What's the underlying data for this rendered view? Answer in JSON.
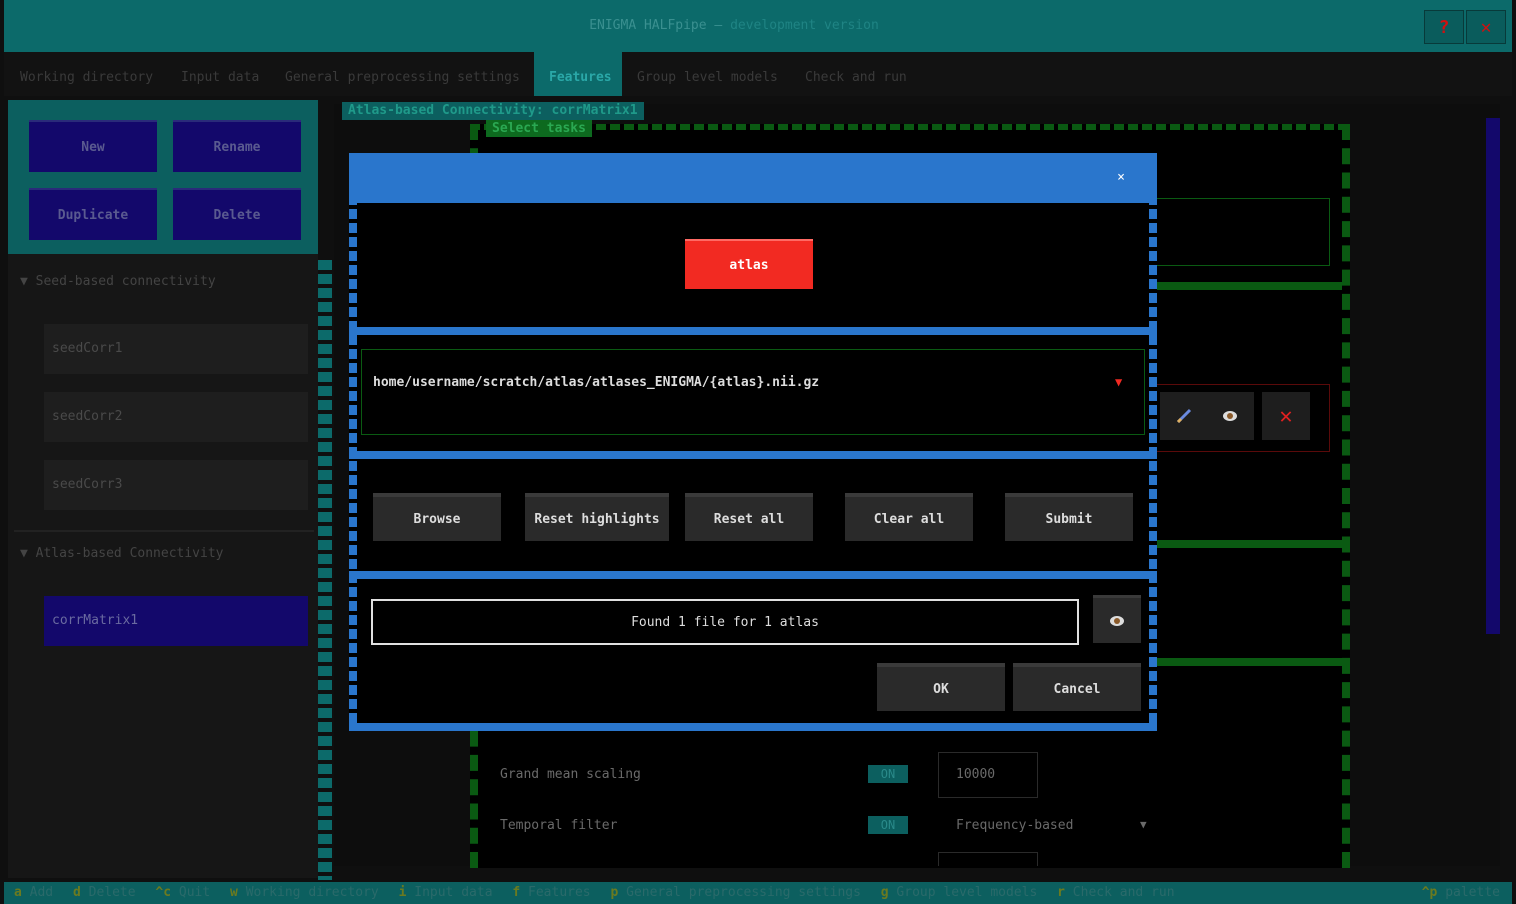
{
  "window": {
    "title": "ENIGMA HALFpipe —",
    "subtitle": "development version",
    "help_label": "?",
    "close_label": "✕"
  },
  "tabs": [
    {
      "label": "Working directory"
    },
    {
      "label": "Input data"
    },
    {
      "label": "General preprocessing settings"
    },
    {
      "label": "Features"
    },
    {
      "label": "Group level models"
    },
    {
      "label": "Check and run"
    }
  ],
  "sidebar": {
    "buttons": {
      "new": "New",
      "rename": "Rename",
      "duplicate": "Duplicate",
      "delete": "Delete"
    },
    "seed_section": "▼ Seed-based connectivity",
    "seed_items": [
      "seedCorr1",
      "seedCorr2",
      "seedCorr3"
    ],
    "atlas_section": "▼ Atlas-based Connectivity",
    "atlas_items": [
      "corrMatrix1"
    ]
  },
  "main": {
    "panel_title": "Atlas-based Connectivity: corrMatrix1",
    "select_tasks": "Select tasks",
    "rows": [
      {
        "label": "Grand mean scaling",
        "toggle": "ON",
        "value": "10000"
      },
      {
        "label": "Temporal filter",
        "toggle": "ON",
        "value": "Frequency-based"
      }
    ]
  },
  "modal": {
    "close": "×",
    "tag": "atlas",
    "path": "home/username/scratch/atlas/atlases_ENIGMA/{atlas}.nii.gz",
    "dropdown_arrow": "▼",
    "buttons": {
      "browse": "Browse",
      "reset_highlights": "Reset highlights",
      "reset_all": "Reset all",
      "clear_all": "Clear all",
      "submit": "Submit"
    },
    "status": "Found 1 file for 1 atlas",
    "ok": "OK",
    "cancel": "Cancel"
  },
  "statusbar": {
    "items": [
      {
        "key": "a",
        "label": "Add"
      },
      {
        "key": "d",
        "label": "Delete"
      },
      {
        "key": "^c",
        "label": "Quit"
      },
      {
        "key": "w",
        "label": "Working directory"
      },
      {
        "key": "i",
        "label": "Input data"
      },
      {
        "key": "f",
        "label": "Features"
      },
      {
        "key": "p",
        "label": "General preprocessing settings"
      },
      {
        "key": "g",
        "label": "Group level models"
      },
      {
        "key": "r",
        "label": "Check and run"
      }
    ],
    "palette": {
      "key": "^p",
      "label": "palette"
    }
  },
  "colors": {
    "teal": "#0c6a6a",
    "navy": "#13086b",
    "modal_blue": "#2a76cc",
    "tag_red": "#f22a22",
    "green": "#0d6a1f"
  }
}
